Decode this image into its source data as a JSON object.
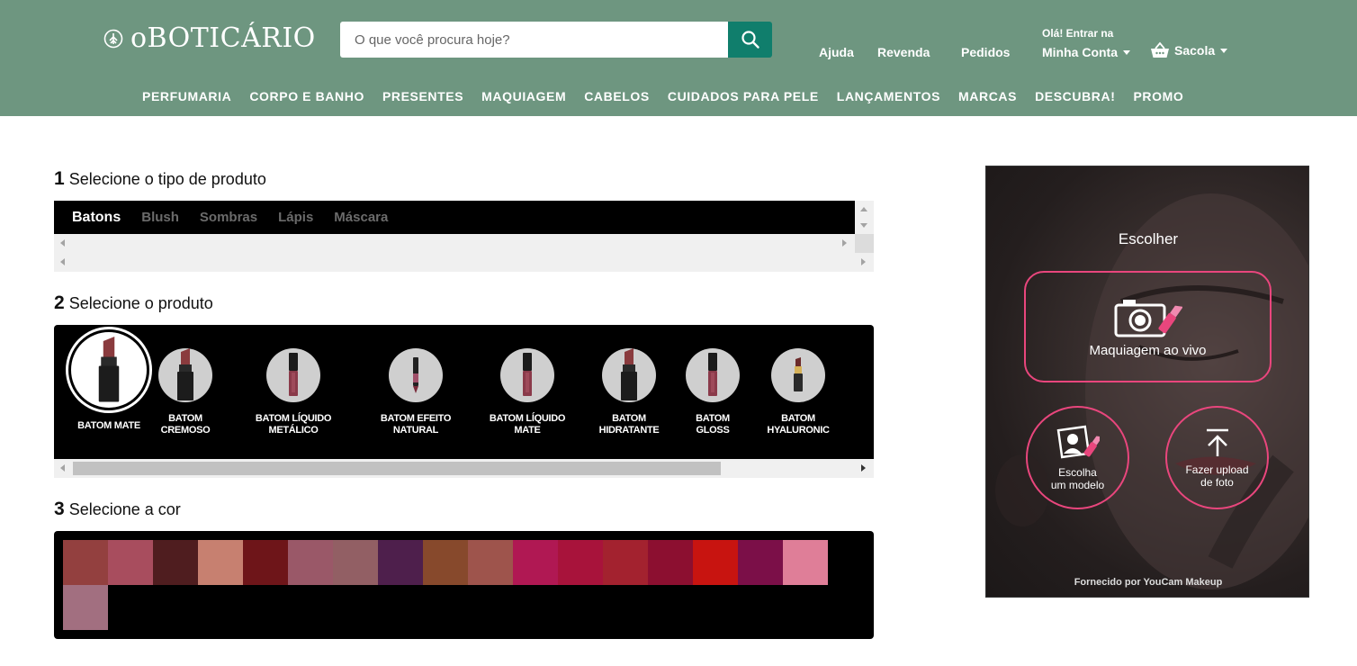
{
  "header": {
    "logo_text": "oBOTICÁRIO",
    "search_placeholder": "O que você procura hoje?",
    "links": {
      "help": "Ajuda",
      "resale": "Revenda",
      "orders": "Pedidos"
    },
    "account": {
      "greeting": "Olá! Entrar na",
      "label": "Minha Conta"
    },
    "bag_label": "Sacola",
    "nav": [
      "PERFUMARIA",
      "CORPO E BANHO",
      "PRESENTES",
      "MAQUIAGEM",
      "CABELOS",
      "CUIDADOS PARA PELE",
      "LANÇAMENTOS",
      "MARCAS",
      "DESCUBRA!",
      "PROMO"
    ]
  },
  "steps": {
    "s1": {
      "num": "1",
      "title": "Selecione o tipo de produto"
    },
    "s2": {
      "num": "2",
      "title": "Selecione o produto"
    },
    "s3": {
      "num": "3",
      "title": "Selecione a cor"
    }
  },
  "product_types": [
    "Batons",
    "Blush",
    "Sombras",
    "Lápis",
    "Máscara"
  ],
  "products": [
    {
      "label": "BATOM MATE",
      "icon": "lipstick-bullet-icon",
      "selected": true
    },
    {
      "label": "BATOM\nCREMOSO",
      "icon": "lipstick-bullet-icon"
    },
    {
      "label": "BATOM LÍQUIDO\nMETÁLICO",
      "icon": "liquid-lipstick-icon"
    },
    {
      "label": "BATOM EFEITO\nNATURAL",
      "icon": "lip-pencil-icon"
    },
    {
      "label": "BATOM LÍQUIDO\nMATE",
      "icon": "liquid-lipstick-icon"
    },
    {
      "label": "BATOM\nHIDRATANTE",
      "icon": "lipstick-bullet-icon"
    },
    {
      "label": "BATOM\nGLOSS",
      "icon": "liquid-lipstick-icon"
    },
    {
      "label": "BATOM\nHYALURONIC",
      "icon": "lipstick-gold-icon"
    }
  ],
  "colors": [
    "#93403f",
    "#a84d5e",
    "#4f1d1f",
    "#c78070",
    "#6e1519",
    "#9a5868",
    "#925f64",
    "#4e1f4c",
    "#87492c",
    "#9e544c",
    "#b01853",
    "#a8133b",
    "#a3222f",
    "#8c0f30",
    "#c81410",
    "#7b0f48",
    "#df7e98",
    "#a26f80"
  ],
  "widget": {
    "title": "Escolher",
    "live_label": "Maquiagem ao vivo",
    "model_label": "Escolha\num modelo",
    "upload_label": "Fazer upload\nde foto",
    "powered_by": "Fornecido por YouCam Makeup"
  }
}
